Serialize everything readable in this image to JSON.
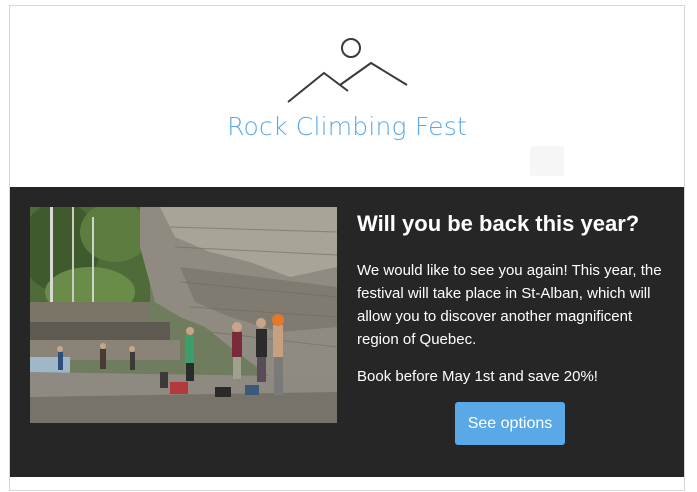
{
  "header": {
    "logo_icon": "mountain-sun-icon",
    "brand_name": "Rock Climbing Fest",
    "brand_color": "#5aa9e6"
  },
  "hero": {
    "image_icon": "climbing-crag-photo",
    "heading": "Will you be back this year?",
    "body": "We would like to see you again! This year, the festival will take place in St-Alban, which will allow you to discover another magnificent region of Quebec.",
    "promo": "Book before May 1st and save 20%!",
    "cta_label": "See options",
    "cta_color": "#5aa9e6",
    "background_color": "#262626"
  }
}
